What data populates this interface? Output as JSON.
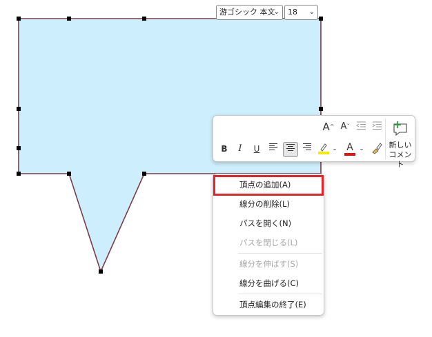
{
  "shape": {
    "fill": "#cdeefc",
    "stroke": "#7a3b45"
  },
  "mini_toolbar": {
    "font_name": "游ゴシック 本文",
    "font_size": "18",
    "grow_font_icon": "A",
    "shrink_font_icon": "A",
    "bold": "B",
    "italic": "I",
    "underline": "U",
    "font_color_letter": "A",
    "highlight_color": "#f5ea00",
    "font_color": "#d51919",
    "new_comment_line1": "新しい",
    "new_comment_line2": "コメント"
  },
  "context_menu": {
    "items": [
      {
        "label": "頂点の追加(A)",
        "enabled": true
      },
      {
        "label": "線分の削除(L)",
        "enabled": true
      },
      {
        "label": "パスを開く(N)",
        "enabled": true
      },
      {
        "label": "パスを閉じる(L)",
        "enabled": false
      },
      {
        "label": "線分を伸ばす(S)",
        "enabled": false
      },
      {
        "label": "線分を曲げる(C)",
        "enabled": true
      },
      {
        "label": "頂点編集の終了(E)",
        "enabled": true
      }
    ],
    "highlight_color": "#e0252b"
  }
}
